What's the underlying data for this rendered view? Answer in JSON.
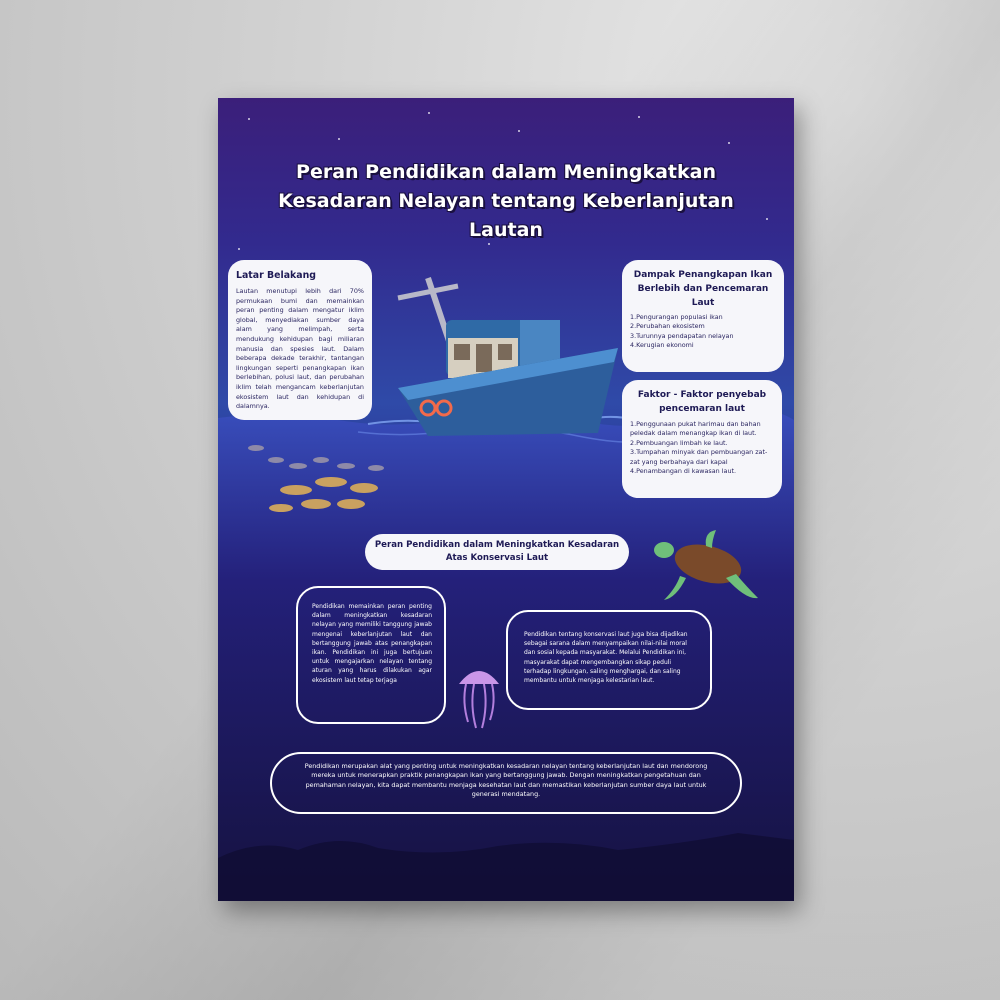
{
  "poster": {
    "title": "Peran Pendidikan dalam Meningkatkan Kesadaran Nelayan tentang Keberlanjutan Lautan",
    "latar_belakang": {
      "heading": "Latar Belakang",
      "body": "Lautan menutupi lebih dari 70% permukaan bumi dan memainkan peran penting dalam mengatur iklim global, menyediakan sumber daya alam yang melimpah, serta mendukung kehidupan bagi miliaran manusia dan spesies laut. Dalam beberapa dekade terakhir, tantangan lingkungan seperti penangkapan ikan berlebihan, polusi laut, dan perubahan iklim telah mengancam keberlanjutan ekosistem laut dan kehidupan di dalamnya."
    },
    "dampak": {
      "heading": "Dampak Penangkapan Ikan Berlebih dan Pencemaran Laut",
      "items": [
        "1.Pengurangan populasi ikan",
        "2.Perubahan ekosistem",
        "3.Turunnya pendapatan nelayan",
        "4.Kerugian ekonomi"
      ]
    },
    "faktor": {
      "heading": "Faktor - Faktor penyebab pencemaran laut",
      "items": [
        "1.Penggunaan pukat harimau dan bahan peledak dalam menangkap ikan di laut.",
        "2.Pembuangan limbah ke laut.",
        "3.Tumpahan minyak dan pembuangan zat-zat yang berbahaya dari kapal",
        "4.Penambangan di kawasan laut."
      ]
    },
    "section_pill": "Peran Pendidikan dalam Meningkatkan Kesadaran Atas Konservasi Laut",
    "left_paragraph": "Pendidikan memainkan peran penting dalam meningkatkan kesadaran nelayan yang memiliki tanggung jawab mengenai keberlanjutan laut dan bertanggung jawab atas penangkapan ikan. Pendidikan ini juga bertujuan untuk mengajarkan nelayan tentang aturan yang harus dilakukan agar ekosistem laut tetap terjaga",
    "right_paragraph": "Pendidikan tentang konservasi laut juga bisa dijadikan sebagai sarana dalam menyampaikan nilai-nilai moral dan sosial kepada masyarakat. Melalui Pendidikan ini, masyarakat dapat mengembangkan sikap peduli terhadap lingkungan, saling menghargai, dan saling membantu untuk menjaga kelestarian laut.",
    "conclusion": "Pendidikan merupakan alat yang penting untuk meningkatkan kesadaran nelayan tentang keberlanjutan laut dan mendorong mereka untuk menerapkan praktik penangkapan ikan yang bertanggung jawab. Dengan meningkatkan pengetahuan dan pemahaman nelayan, kita dapat membantu menjaga kesehatan laut dan memastikan keberlanjutan sumber daya laut untuk generasi mendatang."
  },
  "colors": {
    "poster_top": "#3b1f7a",
    "poster_bottom": "#17134b",
    "box_fill": "#f6f6fa",
    "heading_text": "#1e1a55",
    "boat_hull": "#2d5e9c"
  },
  "icons": [
    "boat-illustration",
    "fish-school-illustration",
    "sea-turtle-illustration",
    "jellyfish-illustration",
    "seabed-silhouette"
  ]
}
